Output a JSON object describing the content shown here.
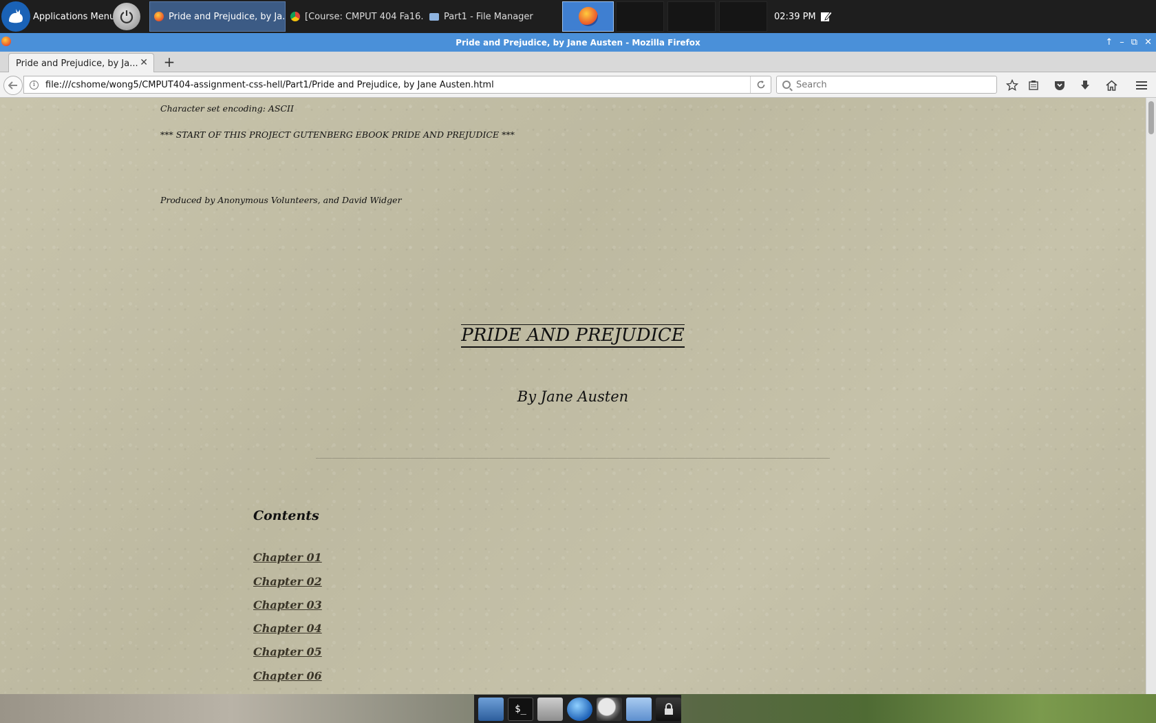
{
  "panel": {
    "apps_menu_label": "Applications Menu",
    "tasks": [
      {
        "label": "Pride and Prejudice, by Ja...",
        "icon": "firefox-icon",
        "active": true
      },
      {
        "label": "[Course: CMPUT 404 Fa16...",
        "icon": "chrome-icon",
        "active": false
      },
      {
        "label": "Part1 - File Manager",
        "icon": "folder-icon",
        "active": false
      }
    ],
    "clock": "02:39 PM"
  },
  "window": {
    "title": "Pride and Prejudice, by Jane Austen - Mozilla Firefox",
    "controls": [
      "↑",
      "–",
      "⧉",
      "✕"
    ]
  },
  "browser": {
    "tab_label": "Pride and Prejudice, by Ja...",
    "url": "file:///cshome/wong5/CMPUT404-assignment-css-hell/Part1/Pride and Prejudice, by Jane Austen.html",
    "search_placeholder": "Search"
  },
  "page": {
    "encoding_line": "Character set encoding: ASCII",
    "start_line": "*** START OF THIS PROJECT GUTENBERG EBOOK PRIDE AND PREJUDICE ***",
    "produced_line": "Produced by Anonymous Volunteers, and David Widger",
    "title": "PRIDE AND PREJUDICE",
    "author": "By Jane Austen",
    "contents_heading": "Contents",
    "chapters": [
      "Chapter 01",
      "Chapter 02",
      "Chapter 03",
      "Chapter 04",
      "Chapter 05",
      "Chapter 06"
    ]
  },
  "colors": {
    "panel_bg": "#1e1e1e",
    "titlebar_bg": "#4a90d9",
    "paper_bg": "#c2bea6",
    "link_color": "#3a3528"
  }
}
